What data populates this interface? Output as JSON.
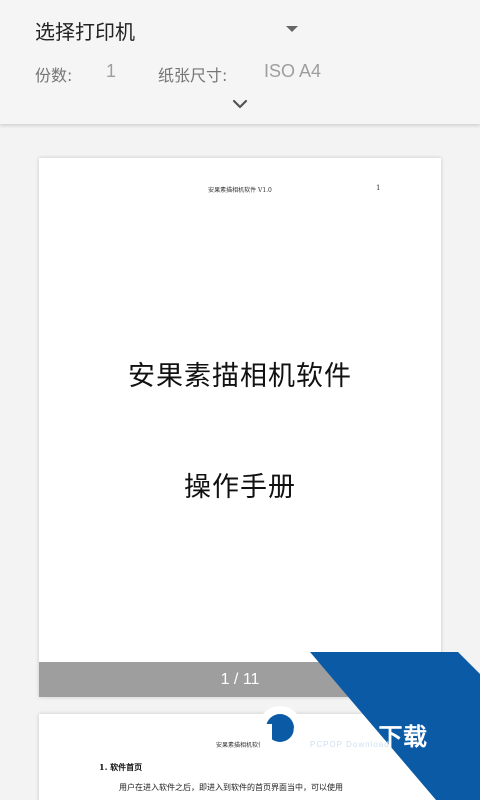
{
  "options": {
    "printer_label": "选择打印机",
    "copies_label": "份数:",
    "copies_value": "1",
    "paper_label": "纸张尺寸:",
    "paper_value": "ISO A4"
  },
  "preview": {
    "page1": {
      "header_text": "安果素描相机软件 V1.0",
      "header_page": "1",
      "title": "安果素描相机软件",
      "subtitle": "操作手册",
      "page_counter": "1 / 11"
    },
    "page2": {
      "header_text": "安果素描相机软件",
      "section_title": "1. 软件首页",
      "body_line": "用户在进入软件之后，即进入到软件的首页界面当中，可以使用"
    }
  },
  "watermark": {
    "brand": "PCPOP下载",
    "sub": "PCPOP Download"
  },
  "colors": {
    "panel_bg": "#f5f5f5",
    "page_bg": "#ffffff",
    "counter_bg": "#9e9e9e",
    "watermark_blue": "#0b5aa6"
  },
  "icons": {
    "printer_dropdown": "dropdown-triangle-icon",
    "expand": "chevron-down-icon"
  }
}
